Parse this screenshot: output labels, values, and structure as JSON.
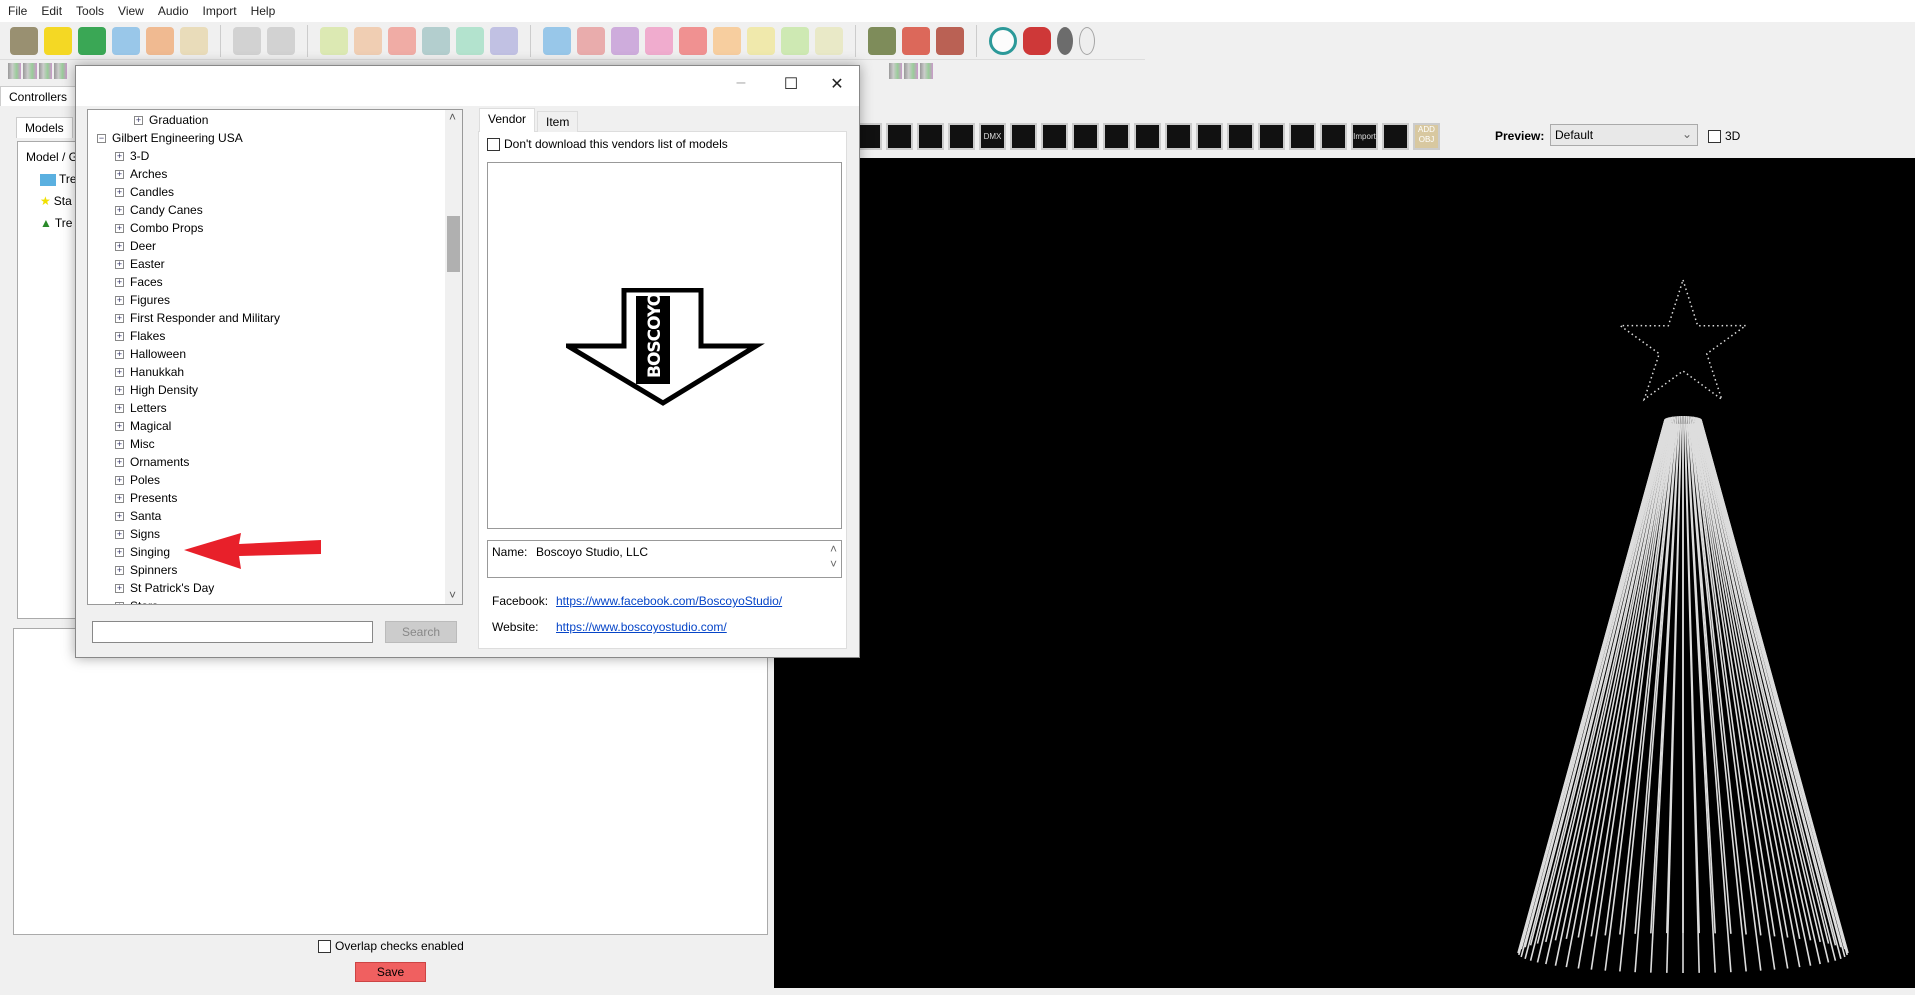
{
  "menu": [
    "File",
    "Edit",
    "Tools",
    "View",
    "Audio",
    "Import",
    "Help"
  ],
  "left": {
    "controllers_tab": "Controllers",
    "models_tab": "Models",
    "model_header": "Model / G",
    "models": [
      "Tre",
      "Sta",
      "Tre"
    ],
    "overlap_label": "Overlap checks enabled",
    "save_label": "Save"
  },
  "right": {
    "preview_label": "Preview:",
    "preview_value": "Default",
    "threed_label": "3D",
    "model_tools": [
      "",
      "",
      "",
      "",
      "DMX",
      "",
      "",
      "",
      "",
      "",
      "",
      "",
      "",
      "",
      "",
      "",
      "Import",
      "",
      "ADD OBJ"
    ]
  },
  "dialog": {
    "tree": {
      "parent_item": "Graduation",
      "vendor": "Gilbert Engineering USA",
      "categories": [
        "3-D",
        "Arches",
        "Candles",
        "Candy Canes",
        "Combo Props",
        "Deer",
        "Easter",
        "Faces",
        "Figures",
        "First Responder and Military",
        "Flakes",
        "Halloween",
        "Hanukkah",
        "High Density",
        "Letters",
        "Magical",
        "Misc",
        "Ornaments",
        "Poles",
        "Presents",
        "Santa",
        "Signs",
        "Singing",
        "Spinners",
        "St Patrick's Day",
        "Stars"
      ]
    },
    "search_placeholder": "",
    "search_label": "Search",
    "tabs": [
      "Vendor",
      "Item"
    ],
    "dont_download_label": "Don't download this vendors list of models",
    "logo_text": "BOSCOYO",
    "name_label": "Name:",
    "name_value": "Boscoyo Studio, LLC",
    "facebook_label": "Facebook:",
    "facebook_url": "https://www.facebook.com/BoscoyoStudio/",
    "website_label": "Website:",
    "website_url": "https://www.boscoyostudio.com/"
  },
  "colors": {
    "arrow": "#e8202a",
    "save": "#f06060"
  }
}
